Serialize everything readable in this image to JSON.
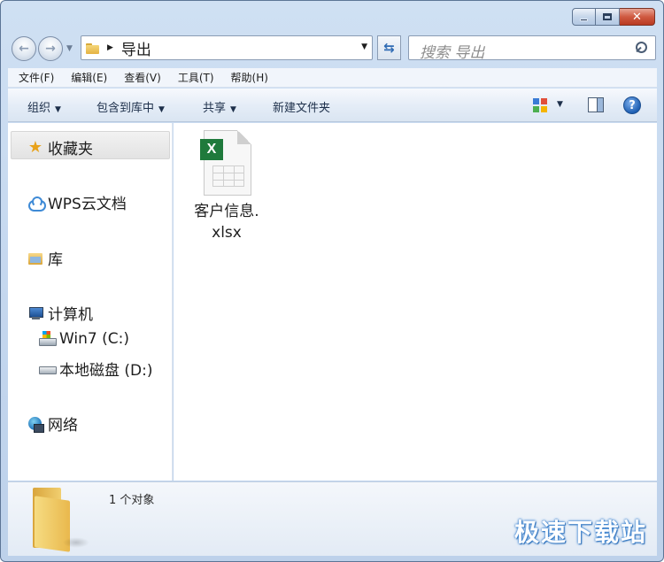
{
  "nav": {
    "address": {
      "folder": "导出"
    },
    "search": {
      "placeholder": "搜索 导出"
    }
  },
  "menu": [
    "文件(F)",
    "编辑(E)",
    "查看(V)",
    "工具(T)",
    "帮助(H)"
  ],
  "toolbar": {
    "organize": "组织",
    "include_library": "包含到库中",
    "share": "共享",
    "new_folder": "新建文件夹"
  },
  "sidebar": {
    "favorites": "收藏夹",
    "wps_cloud": "WPS云文档",
    "library": "库",
    "computer": "计算机",
    "drive_c": "Win7 (C:)",
    "drive_d": "本地磁盘 (D:)",
    "network": "网络"
  },
  "files": [
    {
      "name": "客户信息.xlsx",
      "icon": "excel-xlsx-icon",
      "badge": "X"
    }
  ],
  "details": {
    "object_count": "1 个对象"
  },
  "watermark": "极速下载站",
  "colors": {
    "title_bar": "#c3d6ee",
    "close_button": "#cf5a41",
    "excel_green": "#1f7a3c",
    "folder_yellow": "#e9b84d"
  }
}
